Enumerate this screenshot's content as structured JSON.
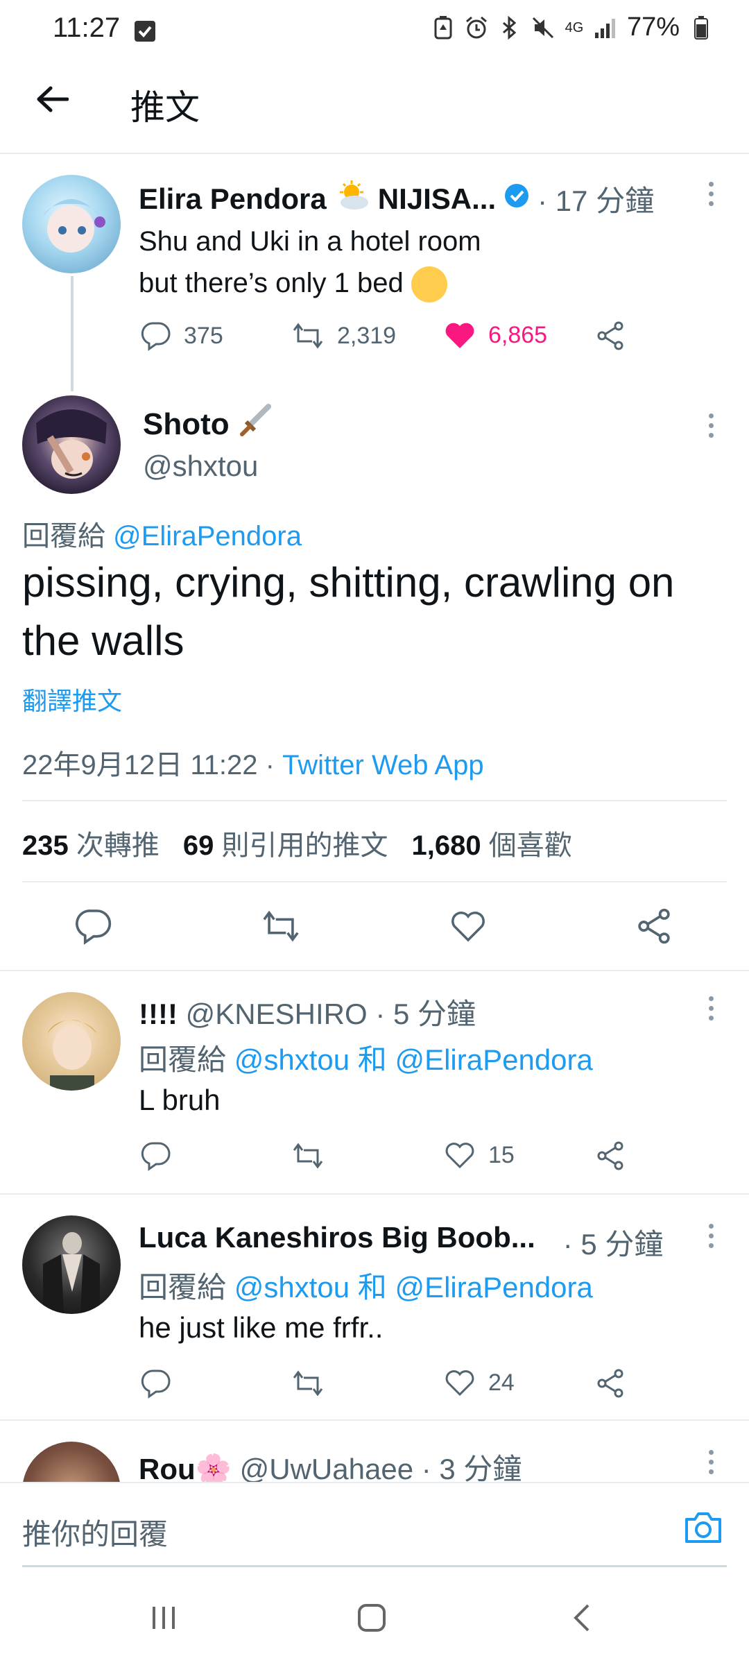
{
  "status_bar": {
    "time": "11:27",
    "network": "4G",
    "battery": "77%",
    "icons": [
      "checkbox-icon",
      "battery-saver-icon",
      "alarm-icon",
      "bluetooth-icon",
      "mute-icon",
      "signal-icon",
      "battery-icon"
    ]
  },
  "header": {
    "title": "推文"
  },
  "parent_tweet": {
    "display_name": "Elira Pendora",
    "name_suffix": "NIJISA...",
    "time": "· 17 分鐘",
    "text_line1": "Shu and Uki in a hotel room",
    "text_line2": "but there’s only 1 bed",
    "emoji": "😳",
    "replies": "375",
    "retweets": "2,319",
    "likes": "6,865",
    "like_color": "#f91880"
  },
  "main_tweet": {
    "display_name": "Shoto",
    "emoji": "🗡️",
    "handle": "@shxtou",
    "reply_prefix": "回覆給",
    "reply_to": "@EliraPendora",
    "text": "pissing, crying, shitting, crawling on the walls",
    "translate": "翻譯推文",
    "date": "22年9月12日 11:22",
    "separator": "·",
    "source": "Twitter Web App",
    "stats": {
      "retweets_count": "235",
      "retweets_label": "次轉推",
      "quotes_count": "69",
      "quotes_label": "則引用的推文",
      "likes_count": "1,680",
      "likes_label": "個喜歡"
    }
  },
  "replies": [
    {
      "name": "!!!!",
      "handle": "@KNESHIRO",
      "time": "· 5 分鐘",
      "reply_prefix": "回覆給",
      "to1": "@shxtou",
      "and": "和",
      "to2": "@EliraPendora",
      "text": "L bruh",
      "likes": "15"
    },
    {
      "name": "Luca Kaneshiros Big Boob...",
      "time": "· 5 分鐘",
      "reply_prefix": "回覆給",
      "to1": "@shxtou",
      "and": "和",
      "to2": "@EliraPendora",
      "text": "he just like me frfr..",
      "likes": "24"
    },
    {
      "name": "Rou",
      "emoji": "🌸",
      "handle": "@UwUahaee",
      "time": "· 3 分鐘"
    }
  ],
  "compose": {
    "placeholder": "推你的回覆"
  },
  "accent": "#1d9bf0"
}
